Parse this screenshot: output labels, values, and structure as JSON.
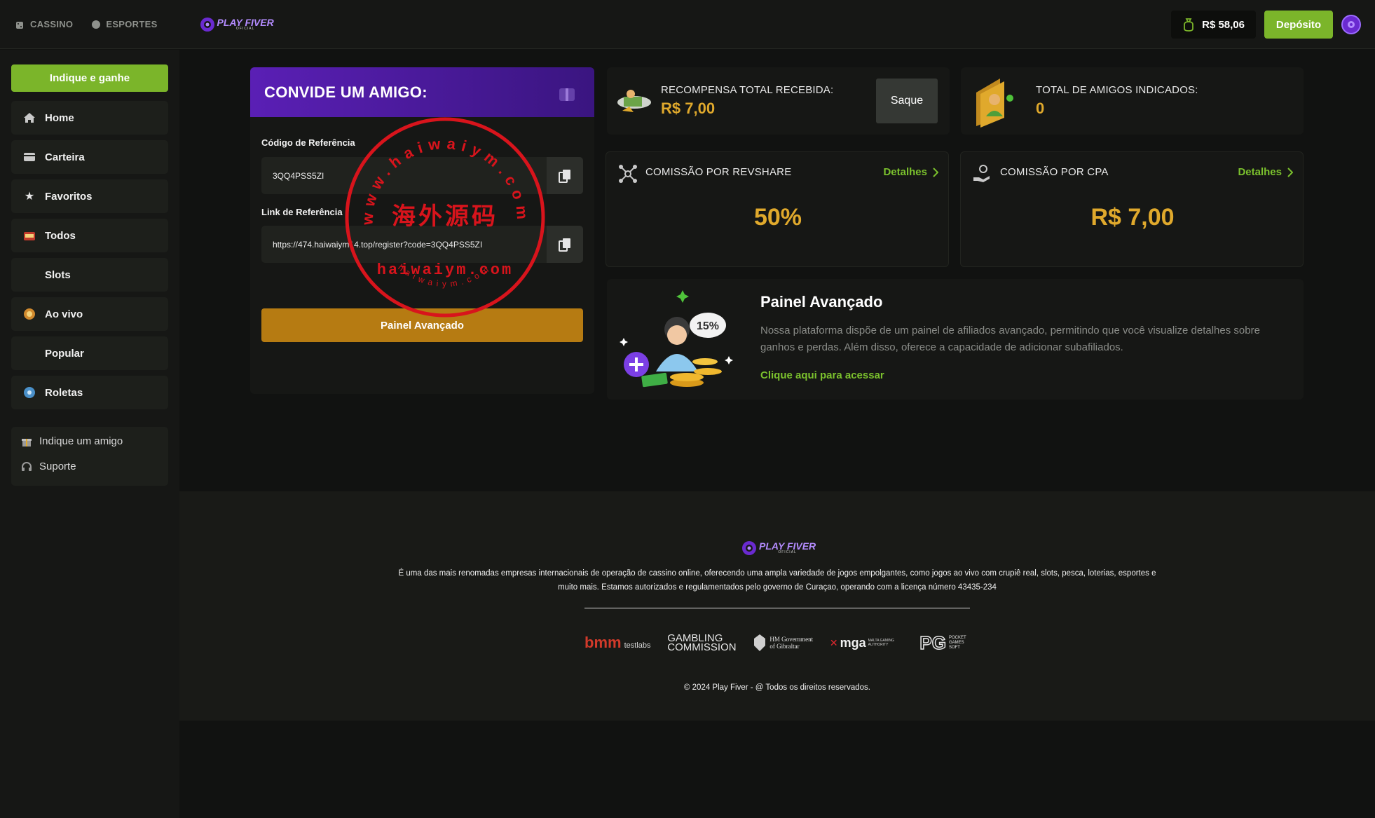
{
  "topbar": {
    "nav": [
      {
        "label": "CASSINO",
        "icon": "dice-icon"
      },
      {
        "label": "ESPORTES",
        "icon": "ball-icon"
      }
    ],
    "logo_text": "PLAY FIVER",
    "logo_sub": "OFICIAL",
    "balance": "R$ 58,06",
    "deposit_label": "Depósito"
  },
  "sidebar": {
    "invite_label": "Indique e ganhe",
    "items": [
      {
        "label": "Home",
        "icon": "home-icon"
      },
      {
        "label": "Carteira",
        "icon": "wallet-icon"
      },
      {
        "label": "Favoritos",
        "icon": "star-icon"
      },
      {
        "label": "Todos",
        "icon": "slot-machine-icon"
      },
      {
        "label": "Slots",
        "icon": ""
      },
      {
        "label": "Ao vivo",
        "icon": "live-icon"
      },
      {
        "label": "Popular",
        "icon": ""
      },
      {
        "label": "Roletas",
        "icon": "roulette-icon"
      }
    ],
    "bottom_links": [
      {
        "label": "Indique um amigo",
        "icon": "gift-icon"
      },
      {
        "label": "Suporte",
        "icon": "headset-icon"
      }
    ]
  },
  "invite": {
    "title": "CONVIDE UM AMIGO:",
    "code_label": "Código de Referência",
    "code_value": "3QQ4PSS5ZI",
    "link_label": "Link de Referência",
    "link_value": "https://474.haiwaiym14.top/register?code=3QQ4PSS5ZI",
    "panel_button": "Painel Avançado"
  },
  "stats": {
    "reward_label": "RECOMPENSA TOTAL RECEBIDA:",
    "reward_value": "R$ 7,00",
    "withdraw_label": "Saque",
    "friends_label": "TOTAL DE AMIGOS INDICADOS:",
    "friends_value": "0",
    "revshare_label": "COMISSÃO POR REVSHARE",
    "revshare_value": "50%",
    "cpa_label": "COMISSÃO POR CPA",
    "cpa_value": "R$ 7,00",
    "details_label": "Detalhes"
  },
  "advanced": {
    "badge": "15%",
    "title": "Painel Avançado",
    "description": "Nossa plataforma dispõe de um painel de afiliados avançado, permitindo que você visualize detalhes sobre ganhos e perdas. Além disso, oferece a capacidade de adicionar subafiliados.",
    "link": "Clique aqui para acessar"
  },
  "watermark": {
    "top_text": "www.haiwaiym.com",
    "chinese": "海外源码",
    "middle": "haiwaiym.com",
    "bottom": "haiwaiym.com"
  },
  "footer": {
    "logo_text": "PLAY FIVER",
    "logo_sub": "OFICIAL",
    "description": "É uma das mais renomadas empresas internacionais de operação de cassino online, oferecendo uma ampla variedade de jogos empolgantes, como jogos ao vivo com crupiê real, slots, pesca, loterias, esportes e muito mais. Estamos autorizados e regulamentados pelo governo de Curaçao, operando com a licença número 43435-234",
    "partners": [
      "bmm",
      "testlabs",
      "GAMBLING",
      "COMMISSION",
      "HM Government",
      "of Gibraltar",
      "mga",
      "MALTA GAMING AUTHORITY",
      "PG",
      "POCKET GAMES SOFT"
    ],
    "copyright": "© 2024 Play Fiver - @ Todos os direitos reservados."
  },
  "colors": {
    "accent_green": "#7bb52a",
    "gold": "#e0a92c",
    "purple": "#5a1fb5",
    "button_gold": "#b67b12"
  }
}
